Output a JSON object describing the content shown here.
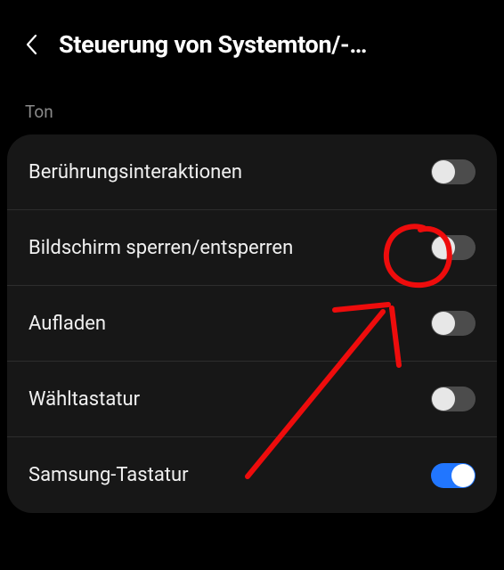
{
  "header": {
    "title": "Steuerung von Systemton/-…"
  },
  "section": {
    "label": "Ton"
  },
  "rows": [
    {
      "label": "Berührungsinteraktionen",
      "on": false
    },
    {
      "label": "Bildschirm sperren/entsperren",
      "on": false
    },
    {
      "label": "Aufladen",
      "on": false
    },
    {
      "label": "Wähltastatur",
      "on": false
    },
    {
      "label": "Samsung-Tastatur",
      "on": true
    }
  ],
  "annotation": {
    "color": "#ee0c0c"
  }
}
